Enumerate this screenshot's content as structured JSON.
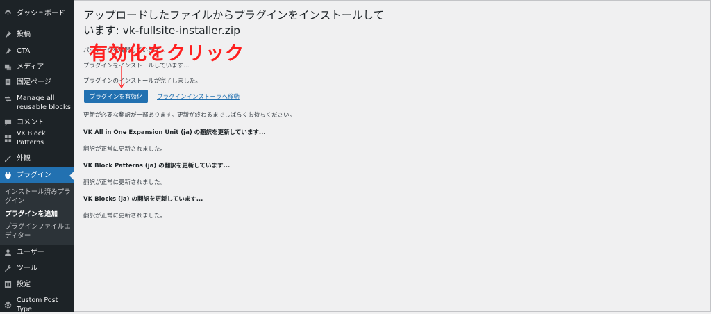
{
  "sidebar": {
    "items": [
      {
        "label": "ダッシュボード",
        "icon": "dashboard-icon"
      },
      {
        "label": "投稿",
        "icon": "pin-icon"
      },
      {
        "label": "CTA",
        "icon": "pin-icon"
      },
      {
        "label": "メディア",
        "icon": "media-icon"
      },
      {
        "label": "固定ページ",
        "icon": "page-icon"
      },
      {
        "label": "Manage all reusable blocks",
        "icon": "blocks-icon"
      },
      {
        "label": "コメント",
        "icon": "comment-icon"
      },
      {
        "label": "VK Block Patterns",
        "icon": "grid-icon"
      },
      {
        "label": "外観",
        "icon": "brush-icon"
      },
      {
        "label": "プラグイン",
        "icon": "plugin-icon"
      },
      {
        "label": "ユーザー",
        "icon": "user-icon"
      },
      {
        "label": "ツール",
        "icon": "wrench-icon"
      },
      {
        "label": "設定",
        "icon": "settings-icon"
      },
      {
        "label": "Custom Post Type",
        "icon": "gear-icon"
      }
    ],
    "submenu": [
      "インストール済みプラグイン",
      "プラグインを追加",
      "プラグインファイルエディター"
    ]
  },
  "main": {
    "title": "アップロードしたファイルからプラグインをインストールしています: vk-fullsite-installer.zip",
    "line1": "パッケージを展開しています…",
    "line2": "プラグインをインストールしています…",
    "line3": "プラグインのインストールが完了しました。",
    "activate_button": "プラグインを有効化",
    "installer_link": "プラグインインストーラへ移動",
    "translation_notice": "更新が必要な翻訳が一部あります。更新が終わるまでしばらくお待ちください。",
    "translations": [
      {
        "heading": "VK All in One Expansion Unit (ja) の翻訳を更新しています...",
        "status": "翻訳が正常に更新されました。"
      },
      {
        "heading": "VK Block Patterns (ja) の翻訳を更新しています...",
        "status": "翻訳が正常に更新されました。"
      },
      {
        "heading": "VK Blocks (ja) の翻訳を更新しています...",
        "status": "翻訳が正常に更新されました。"
      }
    ]
  },
  "annotation": {
    "text": "有効化をクリック",
    "color": "#ff1f1f"
  },
  "colors": {
    "sidebar_bg": "#1d2327",
    "accent": "#2271b1",
    "page_bg": "#f0f0f1"
  }
}
